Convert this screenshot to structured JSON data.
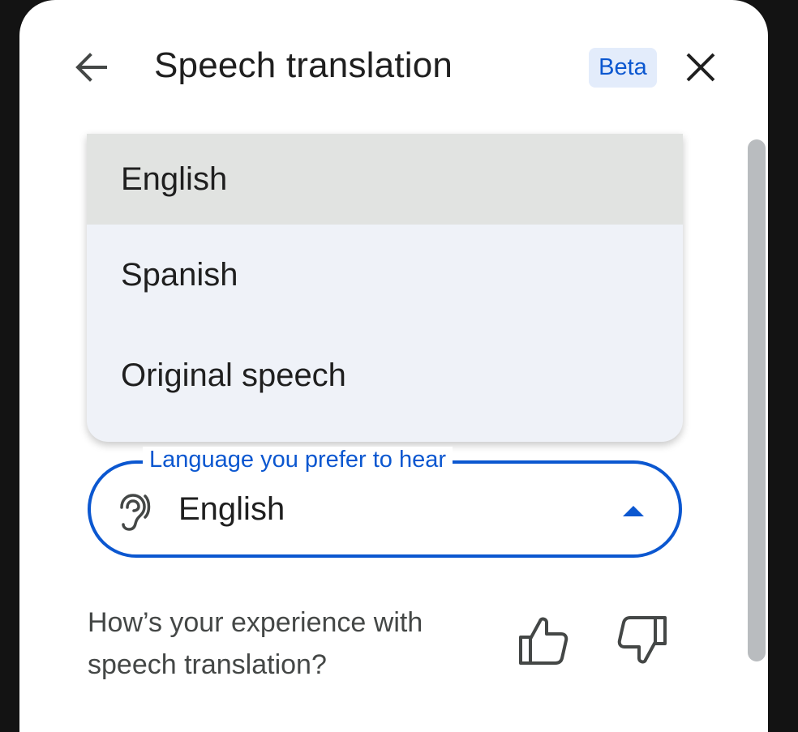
{
  "header": {
    "title": "Speech translation",
    "badge": "Beta",
    "back_icon": "arrow-back-icon",
    "close_icon": "close-icon"
  },
  "dropdown": {
    "options": [
      {
        "label": "English",
        "selected": true
      },
      {
        "label": "Spanish",
        "selected": false
      },
      {
        "label": "Original speech",
        "selected": false
      }
    ]
  },
  "language_field": {
    "label": "Language you prefer to hear",
    "value": "English",
    "icon": "hearing-icon",
    "state": "expanded"
  },
  "feedback": {
    "question": "How’s your experience with speech translation?",
    "like_icon": "thumb-up-icon",
    "dislike_icon": "thumb-down-icon"
  },
  "colors": {
    "accent": "#0b57d0",
    "badge_bg": "#e3ecfb",
    "menu_bg": "#eff2f8",
    "selected_bg": "#e1e3e1",
    "panel_bg": "#ffffff",
    "backdrop": "#131313"
  }
}
